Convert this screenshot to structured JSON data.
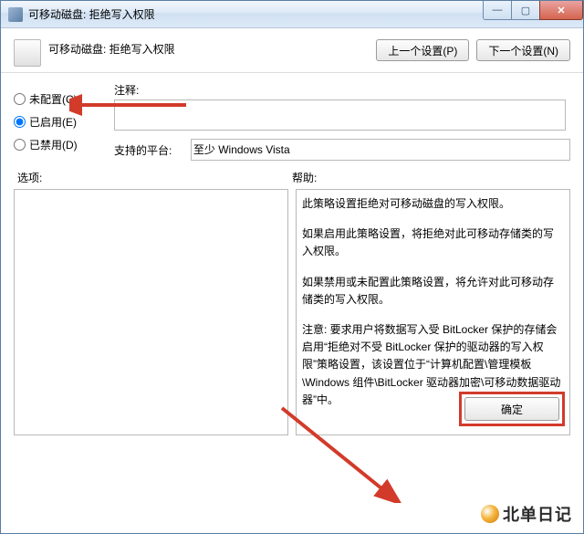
{
  "window": {
    "title": "可移动磁盘: 拒绝写入权限"
  },
  "header": {
    "title": "可移动磁盘: 拒绝写入权限",
    "prev": "上一个设置(P)",
    "next": "下一个设置(N)"
  },
  "radios": {
    "not_configured": "未配置(C)",
    "enabled": "已启用(E)",
    "disabled": "已禁用(D)"
  },
  "labels": {
    "comment": "注释:",
    "platform": "支持的平台:",
    "platform_value": "至少 Windows Vista",
    "options": "选项:",
    "help": "帮助:"
  },
  "help": {
    "p1": "此策略设置拒绝对可移动磁盘的写入权限。",
    "p2": "如果启用此策略设置，将拒绝对此可移动存储类的写入权限。",
    "p3": "如果禁用或未配置此策略设置，将允许对此可移动存储类的写入权限。",
    "p4": "注意: 要求用户将数据写入受 BitLocker 保护的存储会启用“拒绝对不受 BitLocker 保护的驱动器的写入权限”策略设置，该设置位于“计算机配置\\管理模板\\Windows 组件\\BitLocker 驱动器加密\\可移动数据驱动器”中。"
  },
  "footer": {
    "ok": "确定"
  },
  "watermark": "北单日记"
}
